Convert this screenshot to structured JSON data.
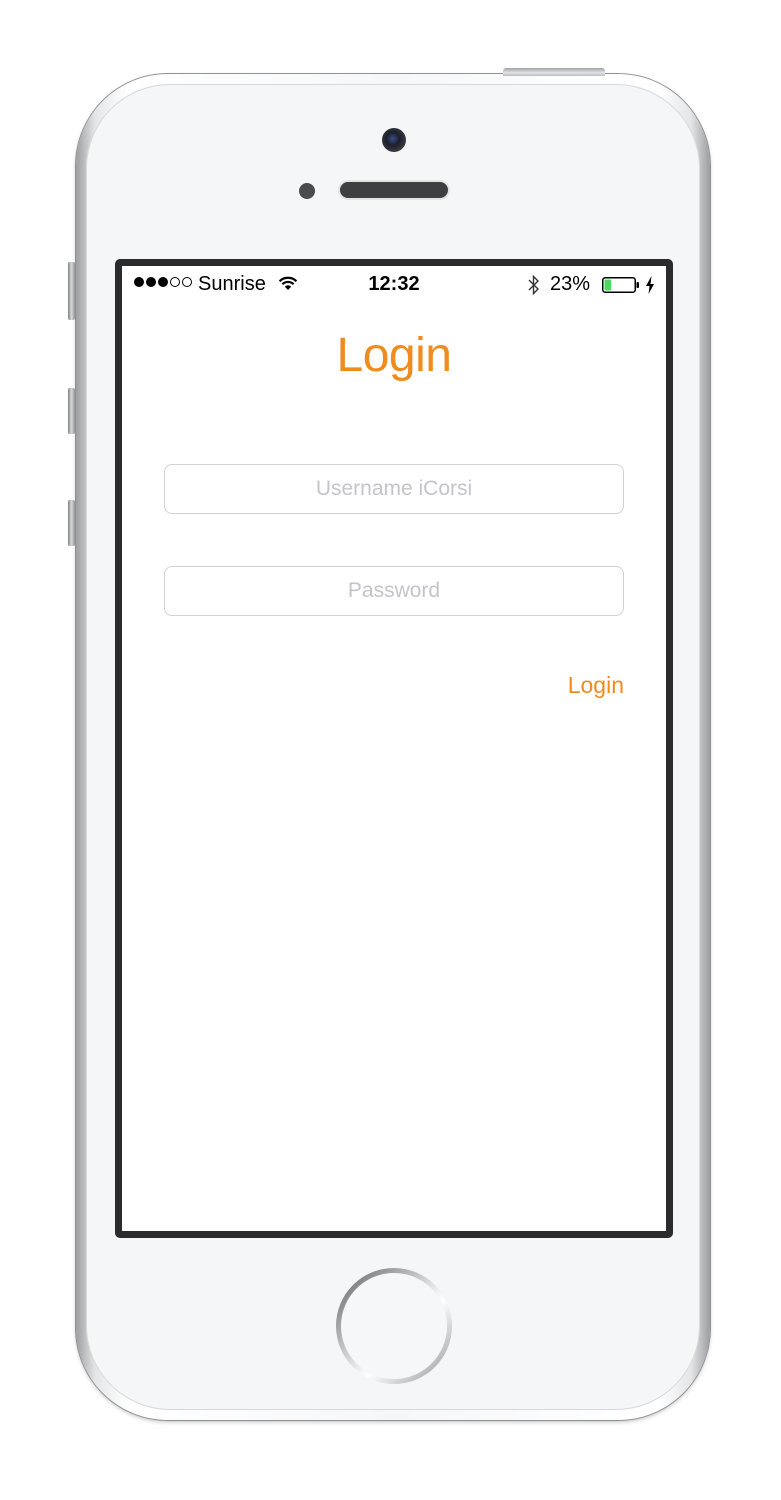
{
  "status_bar": {
    "signal_filled": 3,
    "signal_total": 5,
    "carrier": "Sunrise",
    "time": "12:32",
    "battery_percent": "23%",
    "battery_level": 0.23,
    "icons": [
      "wifi-icon",
      "bluetooth-icon",
      "battery-icon",
      "charging-icon"
    ]
  },
  "login_screen": {
    "title": "Login",
    "username_placeholder": "Username iCorsi",
    "password_placeholder": "Password",
    "login_button_label": "Login"
  },
  "colors": {
    "accent": "#f08c1e",
    "battery_fill": "#4cd964",
    "placeholder": "#c5c5c9",
    "field_border": "#d2d2d4"
  }
}
